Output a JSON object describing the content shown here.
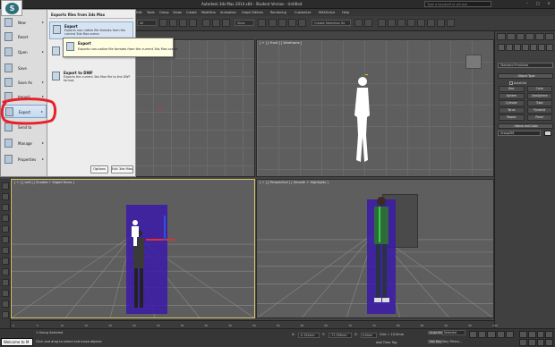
{
  "window": {
    "title": "Autodesk 3ds Max 2014 x64 - Student Version - Untitled",
    "search_placeholder": "Type a keyword or phrase",
    "controls": [
      "–",
      "□",
      "×"
    ]
  },
  "menubar": {
    "items": [
      "Edit",
      "Tools",
      "Group",
      "Views",
      "Create",
      "Modifiers",
      "Animation",
      "Graph Editors",
      "Rendering",
      "Customize",
      "MAXScript",
      "Help"
    ]
  },
  "toolbar": {
    "selection_set": "All",
    "view_select": "View",
    "named_selection": "Create Selection Se"
  },
  "app_menu": {
    "items": [
      {
        "label": "New",
        "icon": "new-icon"
      },
      {
        "label": "Reset",
        "icon": "reset-icon"
      },
      {
        "label": "Open",
        "icon": "open-icon"
      },
      {
        "label": "Save",
        "icon": "save-icon"
      },
      {
        "label": "Save As",
        "icon": "save-as-icon"
      },
      {
        "label": "Import",
        "icon": "import-icon"
      },
      {
        "label": "Export",
        "icon": "export-icon"
      },
      {
        "label": "Send to",
        "icon": "send-to-icon"
      },
      {
        "label": "Manage",
        "icon": "manage-icon"
      },
      {
        "label": "Properties",
        "icon": "properties-icon"
      }
    ],
    "submenu_heading": "Exports files from 3ds Max",
    "submenu": [
      {
        "title": "Export",
        "desc": "Exports non-native file formats from the current 3ds Max scene.",
        "icon": "export-icon"
      },
      {
        "title": "Export Selected",
        "desc": "Exports selected objects to non-native file formats from the current 3ds Max scene.",
        "icon": "export-selected-icon"
      },
      {
        "title": "Export to DWF",
        "desc": "Exports the current 3ds Max file to the DWF format.",
        "icon": "export-dwf-icon"
      }
    ],
    "options_button": "Options",
    "exit_button": "Exit 3ds Max"
  },
  "tooltip": {
    "title": "Export",
    "body": "Exports non-native file formats from the current 3ds Max scene."
  },
  "viewports": {
    "top_right_label": "[ + ] [ Front ] [ Wireframe ]",
    "bottom_left_label": "[ + ] [ Left ] [ Shaded + Edged Faces ]",
    "bottom_right_label": "[ + ] [ Perspective ] [ Smooth + Highlights ]"
  },
  "command_panel": {
    "category": "Standard Primitives",
    "object_type_title": "- Object Type",
    "autogrid": "AutoGrid",
    "buttons": [
      "Box",
      "Cone",
      "Sphere",
      "GeoSphere",
      "Cylinder",
      "Tube",
      "Torus",
      "Pyramid",
      "Teapot",
      "Plane"
    ],
    "name_color_title": "- Name and Color",
    "name_value": "Group001"
  },
  "timeline": {
    "ticks": [
      "0",
      "5",
      "10",
      "15",
      "20",
      "25",
      "30",
      "35",
      "40",
      "45",
      "50",
      "55",
      "60",
      "65",
      "70",
      "75",
      "80",
      "85",
      "90",
      "95",
      "100"
    ]
  },
  "statusbar": {
    "maxscript": "Welcome to M",
    "selection_status": "1 Group Selected",
    "prompt": "Click and drag to select and move objects",
    "x_value": "-0.152mm",
    "y_value": "-71.159mm",
    "z_value": "0.0mm",
    "grid": "Grid = 10.0mm",
    "auto_key": "Auto Key",
    "selected": "Selected",
    "set_key": "Set Key",
    "key_filters": "Key Filters...",
    "add_time_tag": "Add Time Tag"
  },
  "colors": {
    "annotation": "#e8202a",
    "viewport_bg": "#5e5e5e",
    "active_border": "#d8c56a"
  }
}
